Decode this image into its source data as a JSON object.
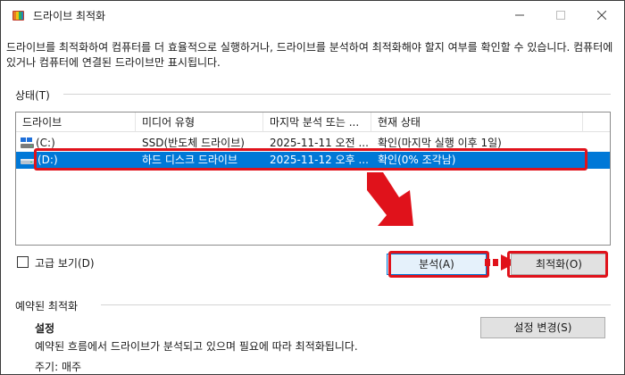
{
  "window": {
    "title": "드라이브 최적화",
    "icon": "defrag-app-icon"
  },
  "description": "드라이브를 최적화하여 컴퓨터를 더 효율적으로 실행하거나, 드라이브를 분석하여 최적화해야 할지 여부를 확인할 수 있습니다. 컴퓨터에 있거나 컴퓨터에 연결된 드라이브만 표시됩니다.",
  "status_section": {
    "label": "상태(T)"
  },
  "drive_list": {
    "columns": [
      "드라이브",
      "미디어 유형",
      "마지막 분석 또는 ...",
      "현재 상태"
    ],
    "rows": [
      {
        "drive": "(C:)",
        "icon": "windows-drive-icon",
        "media": "SSD(반도체 드라이브)",
        "last": "2025-11-11 오전 ...",
        "status": "확인(마지막 실행 이후 1일)",
        "selected": false
      },
      {
        "drive": "(D:)",
        "icon": "hard-drive-icon",
        "media": "하드 디스크 드라이브",
        "last": "2025-11-12 오후 ...",
        "status": "확인(0% 조각남)",
        "selected": true
      }
    ]
  },
  "advanced_view": {
    "label": "고급 보기(D)",
    "checked": false
  },
  "buttons": {
    "analyze": "분석(A)",
    "optimize": "최적화(O)",
    "change_settings": "설정 변경(S)"
  },
  "scheduled": {
    "label": "예약된 최적화",
    "settings_title": "설정",
    "settings_desc": "예약된 흐름에서 드라이브가 분석되고 있으며 필요에 따라 최적화됩니다.",
    "frequency": "주기: 매주"
  },
  "colors": {
    "accent": "#0078d7",
    "highlight_red": "#e0121b"
  }
}
